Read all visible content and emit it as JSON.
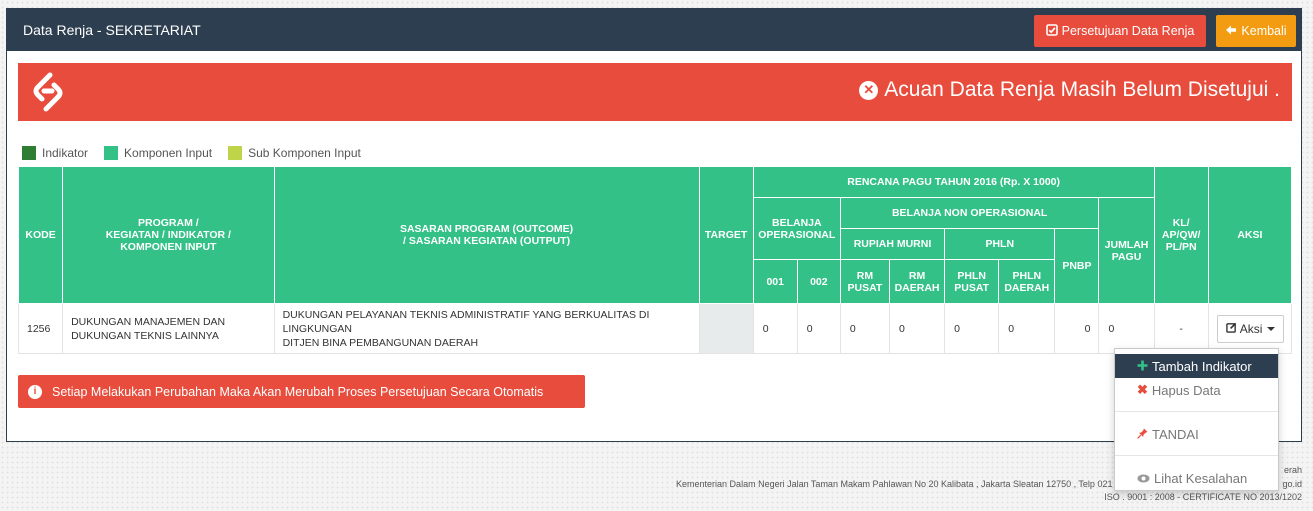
{
  "header": {
    "title": "Data Renja - SEKRETARIAT",
    "approve_label": "Persetujuan Data Renja",
    "back_label": "Kembali"
  },
  "alert": {
    "message": "Acuan Data Renja Masih Belum Disetujui ."
  },
  "legend": [
    {
      "label": "Indikator",
      "color": "#2e7d32"
    },
    {
      "label": "Komponen Input",
      "color": "#33c187"
    },
    {
      "label": "Sub Komponen Input",
      "color": "#c0d44a"
    }
  ],
  "table": {
    "headers": {
      "kode": "KODE",
      "program_1": "PROGRAM /",
      "program_2": "KEGIATAN / INDIKATOR /",
      "program_3": "KOMPONEN INPUT",
      "sasaran_1": "SASARAN PROGRAM (OUTCOME)",
      "sasaran_2": "/ SASARAN KEGIATAN (OUTPUT)",
      "target": "TARGET",
      "rencana": "RENCANA PAGU TAHUN 2016 (Rp. X 1000)",
      "belanja_op_1": "BELANJA",
      "belanja_op_2": "OPERASIONAL",
      "belanja_non_op": "BELANJA NON OPERASIONAL",
      "rupiah_murni": "RUPIAH MURNI",
      "phln": "PHLN",
      "pnbp": "PNBP",
      "jumlah_1": "JUMLAH",
      "jumlah_2": "PAGU",
      "kl_1": "KL/",
      "kl_2": "AP/QW/",
      "kl_3": "PL/PN",
      "aksi": "AKSI",
      "c001": "001",
      "c002": "002",
      "rm_pusat_1": "RM",
      "rm_pusat_2": "PUSAT",
      "rm_daerah_1": "RM",
      "rm_daerah_2": "DAERAH",
      "phln_pusat_1": "PHLN",
      "phln_pusat_2": "PUSAT",
      "phln_daerah_1": "PHLN",
      "phln_daerah_2": "DAERAH"
    },
    "row": {
      "kode": "1256",
      "program_1": "DUKUNGAN MANAJEMEN DAN",
      "program_2": "DUKUNGAN TEKNIS LAINNYA",
      "sasaran_1": "DUKUNGAN PELAYANAN TEKNIS ADMINISTRATIF YANG BERKUALITAS DI LINGKUNGAN",
      "sasaran_2": "DITJEN BINA PEMBANGUNAN DAERAH",
      "target": "",
      "v001": "0",
      "v002": "0",
      "rm_pusat": "0",
      "rm_daerah": "0",
      "phln_pusat": "0",
      "phln_daerah": "0",
      "pnbp": "0",
      "jumlah": "0",
      "kl": "-",
      "aksi_label": "Aksi"
    }
  },
  "warning": "Setiap Melakukan Perubahan Maka Akan Merubah Proses Persetujuan Secara Otomatis",
  "dropdown": {
    "tambah": "Tambah Indikator",
    "hapus": "Hapus Data",
    "tandai": "TANDAI",
    "lihat": "Lihat Kesalahan"
  },
  "footer": {
    "top_partial": "erah",
    "line1": "Kementerian Dalam Negeri Jalan Taman Makam Pahlawan No 20 Kalibata , Jakarta Sleatan 12750 , Telp 021",
    "line1_end": "go.id",
    "line2": "ISO . 9001 : 2008 - CERTIFICATE NO 2013/1202"
  }
}
